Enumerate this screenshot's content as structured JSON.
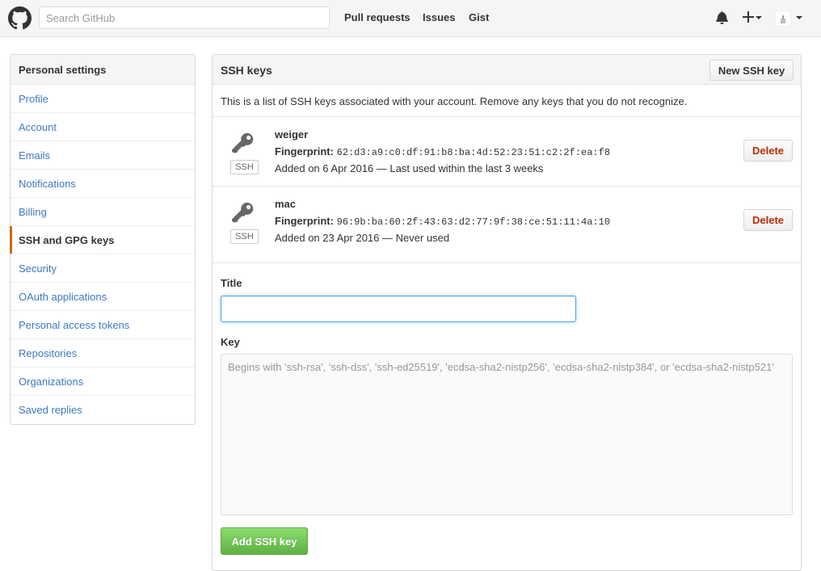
{
  "header": {
    "search_placeholder": "Search GitHub",
    "nav": [
      "Pull requests",
      "Issues",
      "Gist"
    ],
    "icons": [
      "github-logo-icon",
      "bell-icon",
      "plus-icon",
      "avatar"
    ]
  },
  "sidebar": {
    "title": "Personal settings",
    "items": [
      {
        "label": "Profile"
      },
      {
        "label": "Account"
      },
      {
        "label": "Emails"
      },
      {
        "label": "Notifications"
      },
      {
        "label": "Billing"
      },
      {
        "label": "SSH and GPG keys",
        "selected": true
      },
      {
        "label": "Security"
      },
      {
        "label": "OAuth applications"
      },
      {
        "label": "Personal access tokens"
      },
      {
        "label": "Repositories"
      },
      {
        "label": "Organizations"
      },
      {
        "label": "Saved replies"
      }
    ]
  },
  "main": {
    "title": "SSH keys",
    "new_key_label": "New SSH key",
    "intro": "This is a list of SSH keys associated with your account. Remove any keys that you do not recognize.",
    "fingerprint_label": "Fingerprint:",
    "badge": "SSH",
    "delete_label": "Delete",
    "keys": [
      {
        "name": "weiger",
        "fingerprint": "62:d3:a9:c0:df:91:b8:ba:4d:52:23:51:c2:2f:ea:f8",
        "meta": "Added on 6 Apr 2016 — Last used within the last 3 weeks"
      },
      {
        "name": "mac",
        "fingerprint": "96:9b:ba:60:2f:43:63:d2:77:9f:38:ce:51:11:4a:10",
        "meta": "Added on 23 Apr 2016 — Never used"
      }
    ],
    "form": {
      "title_label": "Title",
      "title_value": "",
      "key_label": "Key",
      "key_placeholder": "Begins with 'ssh-rsa', 'ssh-dss', 'ssh-ed25519', 'ecdsa-sha2-nistp256', 'ecdsa-sha2-nistp384', or 'ecdsa-sha2-nistp521'",
      "submit_label": "Add SSH key"
    }
  },
  "colors": {
    "link": "#4078c0",
    "selected_indicator": "#d26911",
    "delete": "#bd2c00",
    "primary_button": "#60b044",
    "focus": "#51a7e8"
  }
}
